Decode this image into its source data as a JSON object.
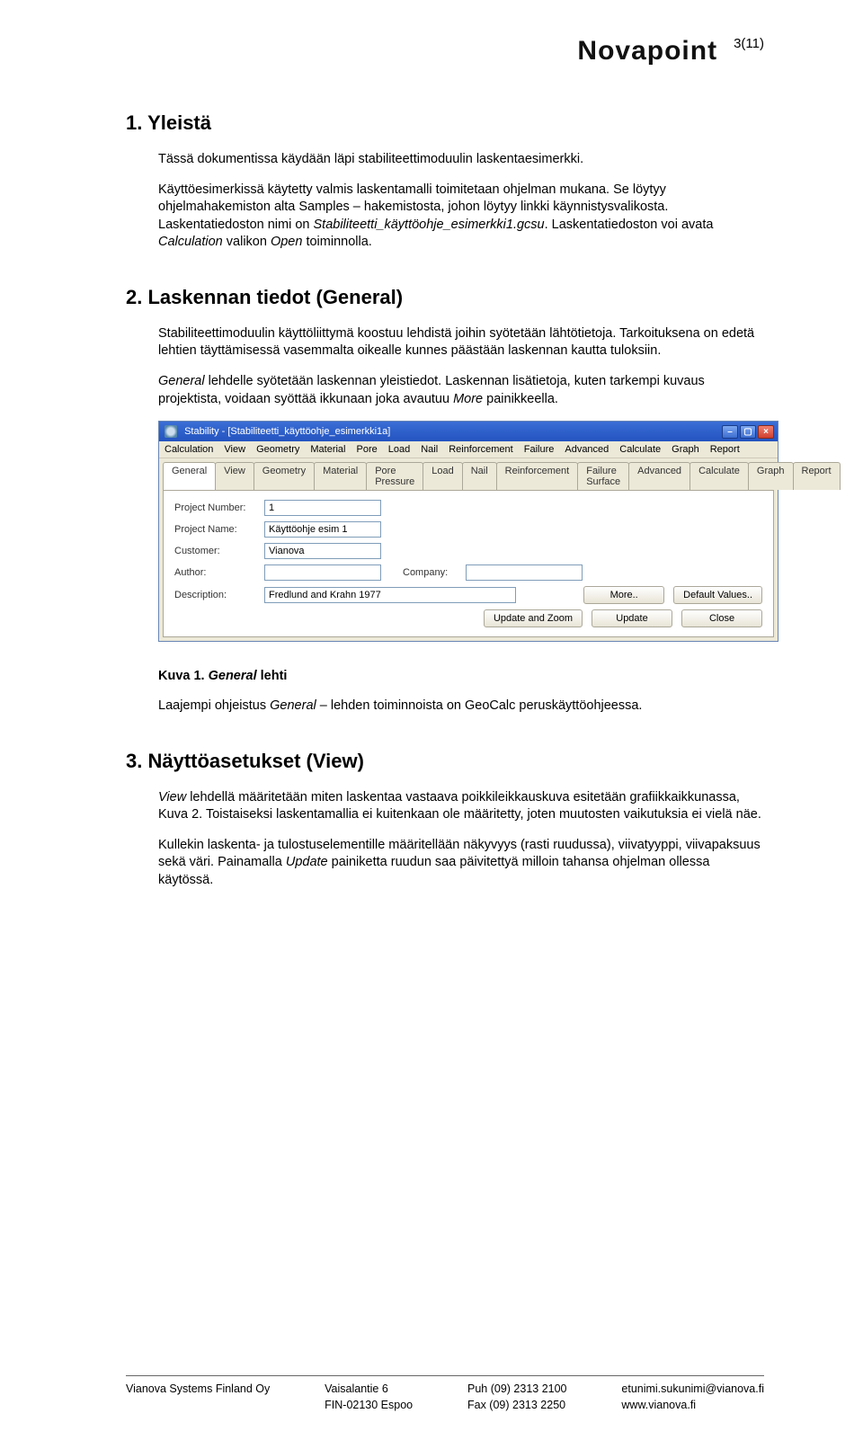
{
  "header": {
    "logo_text": "Novapoint",
    "page_num": "3(11)"
  },
  "s1": {
    "title": "1. Yleistä",
    "p1": "Tässä dokumentissa käydään läpi stabiliteettimoduulin laskentaesimerkki.",
    "p2": "Käyttöesimerkissä käytetty valmis laskentamalli toimitetaan ohjelman mukana. Se löytyy ohjelmahakemiston alta Samples – hakemistosta, johon löytyy linkki käynnistysvalikosta. Laskentatiedoston nimi on ",
    "p2_i1": "Stabiliteetti_käyttöohje_esimerkki1.gcsu",
    "p2_mid": ". Laskentatiedoston voi avata ",
    "p2_i2": "Calculation",
    "p2_mid2": " valikon ",
    "p2_i3": "Open",
    "p2_end": " toiminnolla."
  },
  "s2": {
    "title": "2. Laskennan tiedot (General)",
    "p1": "Stabiliteettimoduulin käyttöliittymä koostuu lehdistä joihin syötetään lähtötietoja. Tarkoituksena on edetä lehtien täyttämisessä vasemmalta oikealle kunnes päästään laskennan kautta tuloksiin.",
    "p2_i": "General",
    "p2_a": " lehdelle syötetään laskennan yleistiedot. Laskennan lisätietoja, kuten tarkempi kuvaus projektista, voidaan syöttää ikkunaan joka avautuu ",
    "p2_b": "More",
    "p2_c": " painikkeella.",
    "caption_a": "Kuva 1. ",
    "caption_b": "General",
    "caption_c": " lehti",
    "p3_a": "Laajempi ohjeistus ",
    "p3_b": "General",
    "p3_c": " – lehden toiminnoista on GeoCalc peruskäyttöohjeessa."
  },
  "screenshot": {
    "title": "Stability - [Stabiliteetti_käyttöohje_esimerkki1a]",
    "menus": [
      "Calculation",
      "View",
      "Geometry",
      "Material",
      "Pore",
      "Load",
      "Nail",
      "Reinforcement",
      "Failure",
      "Advanced",
      "Calculate",
      "Graph",
      "Report"
    ],
    "tabs": [
      "General",
      "View",
      "Geometry",
      "Material",
      "Pore Pressure",
      "Load",
      "Nail",
      "Reinforcement",
      "Failure Surface",
      "Advanced",
      "Calculate",
      "Graph",
      "Report"
    ],
    "labels": {
      "project_number": "Project Number:",
      "project_name": "Project Name:",
      "customer": "Customer:",
      "author": "Author:",
      "company": "Company:",
      "description": "Description:"
    },
    "values": {
      "project_number": "1",
      "project_name": "Käyttöohje esim 1",
      "customer": "Vianova",
      "author": "",
      "company": "",
      "description": "Fredlund and Krahn 1977"
    },
    "buttons": {
      "more": "More..",
      "defaults": "Default Values..",
      "update_zoom": "Update and Zoom",
      "update": "Update",
      "close": "Close"
    }
  },
  "s3": {
    "title": "3. Näyttöasetukset (View)",
    "p1_i": "View",
    "p1_a": " lehdellä määritetään miten laskentaa vastaava poikkileikkauskuva esitetään grafiikkaikkunassa, Kuva 2. Toistaiseksi laskentamallia ei kuitenkaan ole määritetty, joten muutosten vaikutuksia ei vielä näe.",
    "p2_a": "Kullekin laskenta- ja tulostuselementille määritellään näkyvyys (rasti ruudussa), viivatyyppi, viivapaksuus sekä väri. Painamalla ",
    "p2_i": "Update",
    "p2_b": " painiketta ruudun saa päivitettyä milloin tahansa ohjelman ollessa käytössä."
  },
  "footer": {
    "c1": "Vianova Systems Finland Oy",
    "c2": "Vaisalantie 6\nFIN-02130 Espoo",
    "c3": "Puh (09) 2313 2100\nFax (09) 2313 2250",
    "c4": "etunimi.sukunimi@vianova.fi\nwww.vianova.fi"
  }
}
